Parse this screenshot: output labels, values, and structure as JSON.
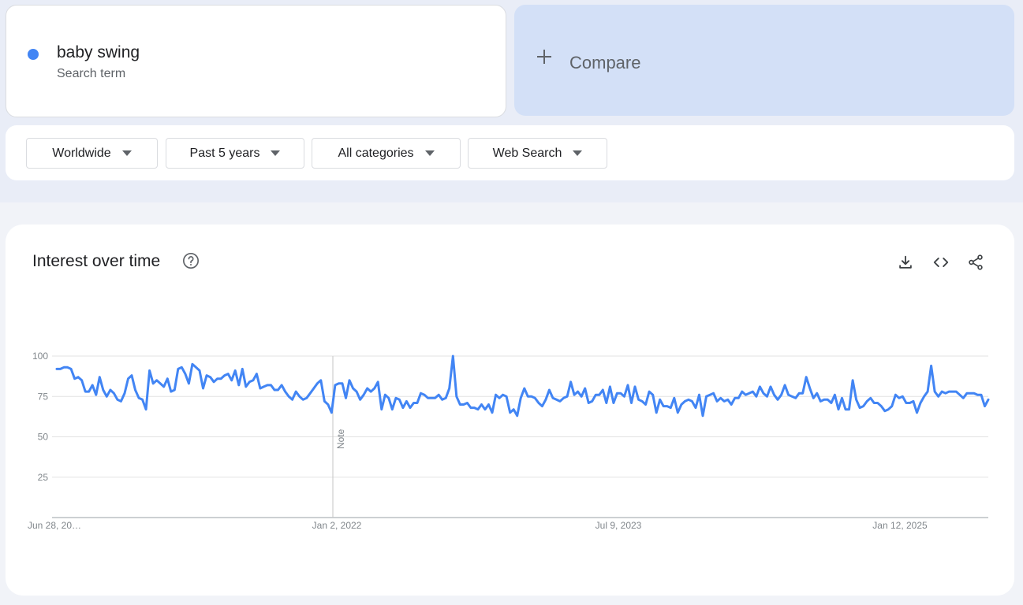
{
  "term": {
    "name": "baby swing",
    "subtitle": "Search term",
    "dot_color": "#4285f4"
  },
  "compare": {
    "label": "Compare"
  },
  "filters": [
    {
      "label": "Worldwide"
    },
    {
      "label": "Past 5 years"
    },
    {
      "label": "All categories"
    },
    {
      "label": "Web Search"
    }
  ],
  "card": {
    "title": "Interest over time",
    "icons": [
      "help-icon",
      "download-icon",
      "embed-code-icon",
      "share-icon"
    ]
  },
  "chart_data": {
    "type": "line",
    "x_tick_labels": [
      "Jun 28, 20…",
      "Jan 2, 2022",
      "Jul 9, 2023",
      "Jan 12, 2025"
    ],
    "y_ticks": [
      25,
      50,
      75,
      100
    ],
    "ylim": [
      0,
      100
    ],
    "grid": true,
    "annotation": {
      "label": "Note",
      "at_index": 78
    },
    "series": [
      {
        "color": "#4285f4",
        "values": [
          92,
          92,
          93,
          93,
          92,
          86,
          87,
          85,
          78,
          78,
          82,
          76,
          87,
          79,
          75,
          79,
          77,
          73,
          72,
          77,
          86,
          88,
          79,
          74,
          73,
          67,
          91,
          83,
          85,
          83,
          81,
          86,
          78,
          79,
          92,
          93,
          89,
          83,
          95,
          93,
          91,
          80,
          88,
          87,
          84,
          86,
          86,
          88,
          89,
          85,
          91,
          82,
          92,
          81,
          84,
          85,
          89,
          80,
          81,
          82,
          82,
          79,
          79,
          82,
          78,
          75,
          73,
          78,
          75,
          73,
          74,
          77,
          80,
          83,
          85,
          72,
          70,
          65,
          82,
          83,
          83,
          74,
          85,
          80,
          78,
          73,
          76,
          80,
          78,
          80,
          84,
          67,
          76,
          74,
          67,
          74,
          73,
          68,
          72,
          68,
          71,
          71,
          77,
          76,
          74,
          74,
          74,
          76,
          73,
          74,
          80,
          100,
          75,
          70,
          70,
          71,
          68,
          68,
          67,
          70,
          67,
          70,
          65,
          76,
          74,
          76,
          75,
          65,
          67,
          63,
          74,
          80,
          75,
          75,
          74,
          71,
          69,
          73,
          79,
          74,
          73,
          72,
          74,
          75,
          84,
          76,
          78,
          75,
          80,
          71,
          72,
          76,
          76,
          79,
          71,
          81,
          71,
          77,
          77,
          75,
          82,
          71,
          81,
          73,
          72,
          70,
          78,
          76,
          65,
          73,
          69,
          69,
          68,
          74,
          65,
          70,
          72,
          73,
          72,
          68,
          76,
          63,
          75,
          76,
          77,
          72,
          74,
          72,
          73,
          70,
          74,
          74,
          78,
          76,
          77,
          78,
          75,
          81,
          77,
          75,
          81,
          76,
          73,
          76,
          82,
          76,
          75,
          74,
          77,
          77,
          87,
          80,
          74,
          77,
          72,
          73,
          73,
          71,
          76,
          67,
          74,
          67,
          67,
          85,
          73,
          68,
          69,
          72,
          74,
          71,
          71,
          69,
          66,
          67,
          69,
          76,
          74,
          75,
          71,
          71,
          72,
          65,
          71,
          75,
          78,
          94,
          78,
          75,
          78,
          77,
          78,
          78,
          78,
          76,
          74,
          77,
          77,
          77,
          76,
          76,
          69,
          73
        ]
      }
    ]
  }
}
